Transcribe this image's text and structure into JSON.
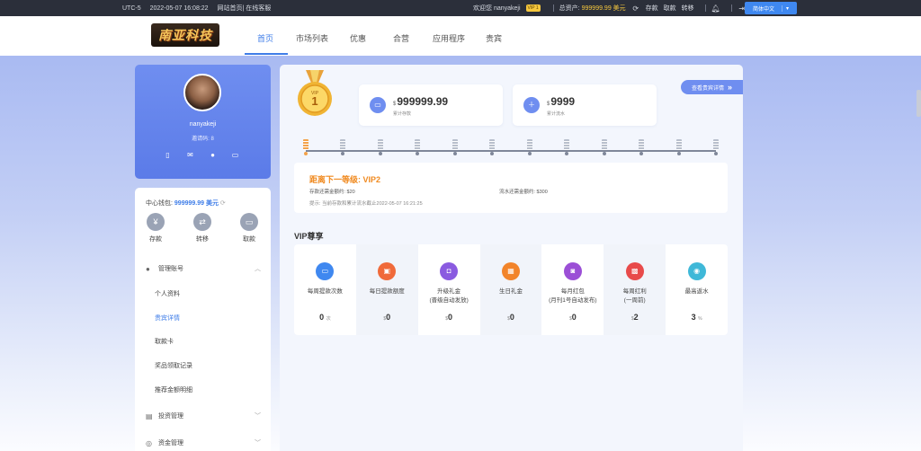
{
  "topbar": {
    "timezone": "UTC-5",
    "datetime": "2022-05-07 16:08:22",
    "links": "网站首页| 在线客服",
    "welcome": "欢迎您 nanyakeji",
    "vip_tag": "VIP 1",
    "assets_label": "总资产:",
    "assets_value": "999999.99 美元",
    "deposit": "存款",
    "withdraw": "取款",
    "transfer": "转移",
    "language": "简体中文"
  },
  "nav": {
    "logo_text": "南亚科技",
    "items": [
      "首页",
      "市场列表",
      "优惠",
      "合营",
      "应用程序",
      "贵宾"
    ]
  },
  "profile": {
    "name": "nanyakeji",
    "invite": "邀请码: 8"
  },
  "wallet": {
    "label": "中心钱包:",
    "amount": "999999.99 美元",
    "actions": [
      "存款",
      "转移",
      "取款"
    ]
  },
  "menu": {
    "account": "管理账号",
    "items": [
      "个人资料",
      "贵宾详情",
      "取款卡",
      "奖品领取记录",
      "推荐金额明细"
    ],
    "invest": "投资管理",
    "funds": "资金管理"
  },
  "vip": {
    "medal_label": "VIP",
    "level": "1",
    "stat1_currency": "$",
    "stat1_value": "999999.99",
    "stat1_label": "累计存款",
    "stat2_currency": "$",
    "stat2_value": "9999",
    "stat2_label": "累计流水",
    "detail_button": "查看贵宾详情",
    "upgrade_title": "距离下一等级: VIP2",
    "deposit_need": "存款还需金额约: $20",
    "turnover_need": "流水还需金额约: $300",
    "tip": "提示: 当前存款和累计流水截止2022-05-07 16:21:25",
    "section_title": "VIP尊享",
    "perks": [
      {
        "label": "每周提款次数",
        "label2": "",
        "value": "0",
        "unit": "次",
        "prefix": ""
      },
      {
        "label": "每日提款额度",
        "label2": "",
        "value": "0",
        "unit": "",
        "prefix": "$"
      },
      {
        "label": "升级礼金",
        "label2": "(晋级自动发放)",
        "value": "0",
        "unit": "",
        "prefix": "$"
      },
      {
        "label": "生日礼金",
        "label2": "",
        "value": "0",
        "unit": "",
        "prefix": "$"
      },
      {
        "label": "每月红包",
        "label2": "(月刊1号自动发布)",
        "value": "0",
        "unit": "",
        "prefix": "$"
      },
      {
        "label": "每周红利",
        "label2": "(一周前)",
        "value": "2",
        "unit": "",
        "prefix": "$"
      },
      {
        "label": "最高返水",
        "label2": "",
        "value": "3",
        "unit": "%",
        "prefix": ""
      }
    ]
  },
  "colors": {
    "accent": "#3f7de8",
    "gold": "#f5c73d",
    "orange": "#f08a20",
    "perk_icons": [
      "#3f88f0",
      "#f06a3a",
      "#8a5be0",
      "#f2842a",
      "#9b4fd6",
      "#e84a4a",
      "#3fb8d8"
    ]
  },
  "progress": {
    "levels": 12,
    "current": 1
  }
}
